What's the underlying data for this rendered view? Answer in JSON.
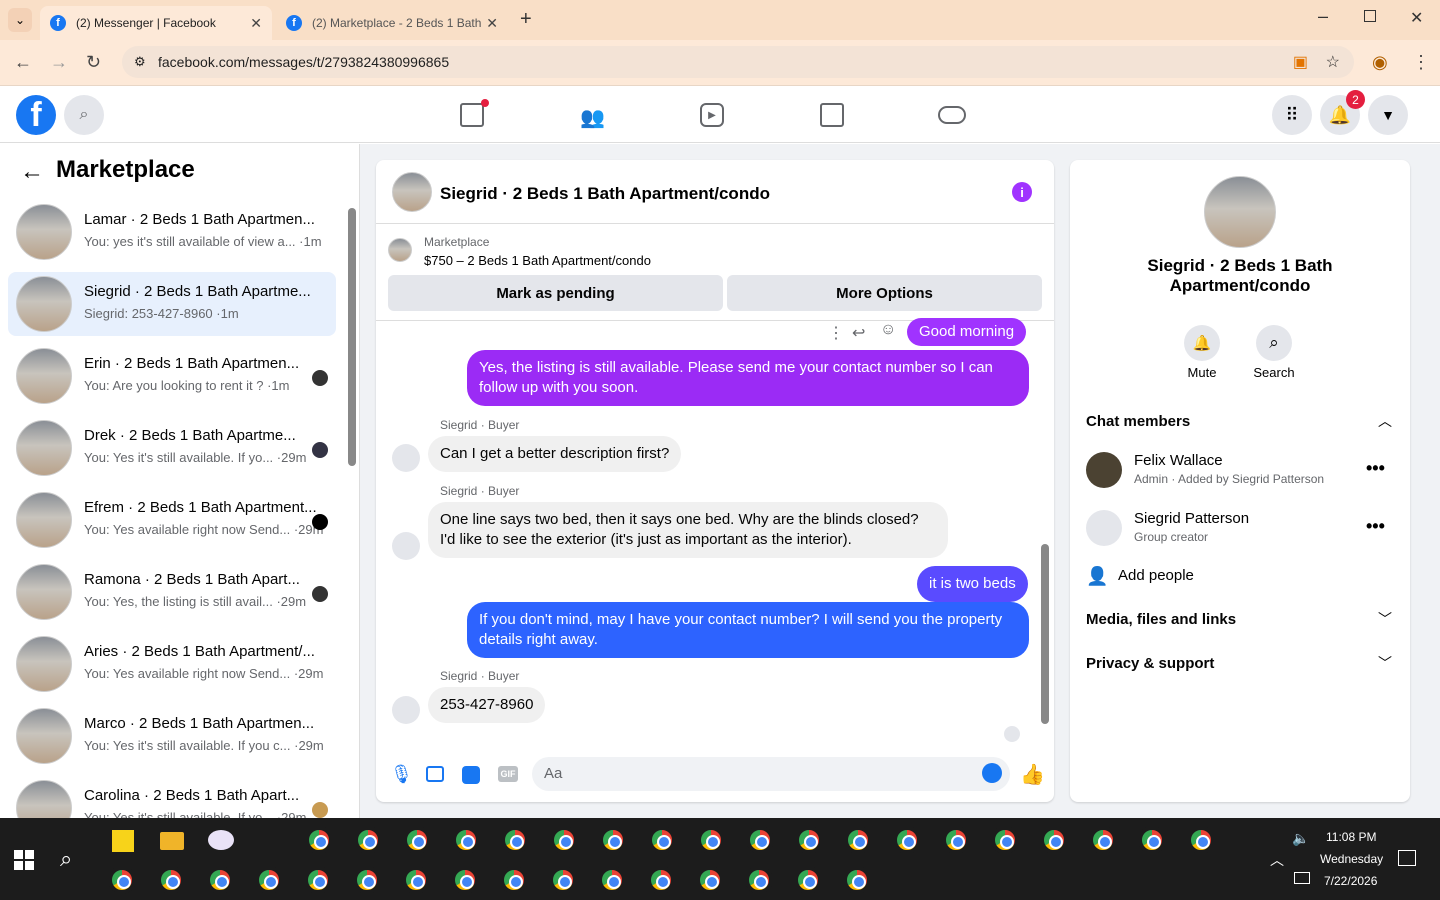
{
  "browser": {
    "tabs": [
      {
        "title": "(2) Messenger | Facebook"
      },
      {
        "title": "(2) Marketplace - 2 Beds 1 Bath"
      }
    ],
    "url": "facebook.com/messages/t/2793824380996865"
  },
  "fb_header": {
    "notifications_count": "2",
    "icons": [
      "facebook-logo",
      "search-icon",
      "home-icon",
      "friends-icon",
      "watch-icon",
      "marketplace-icon",
      "gaming-icon",
      "menu-grid-icon",
      "bell-icon",
      "account-chevron-icon"
    ]
  },
  "sidebar": {
    "title": "Marketplace",
    "conversations": [
      {
        "name": "Lamar · 2 Beds 1 Bath Apartmen...",
        "preview": "You: yes it's still available of view a... ·1m"
      },
      {
        "name": "Siegrid · 2 Beds 1 Bath Apartme...",
        "preview": "Siegrid: 253-427-8960 ·1m"
      },
      {
        "name": "Erin · 2 Beds 1 Bath Apartmen...",
        "preview": "You: Are you looking to rent it ? ·1m"
      },
      {
        "name": "Drek · 2 Beds 1 Bath Apartme...",
        "preview": "You: Yes it's still available. If yo... ·29m"
      },
      {
        "name": "Efrem · 2 Beds 1 Bath Apartment...",
        "preview": "You: Yes available right now Send... ·29m"
      },
      {
        "name": "Ramona · 2 Beds 1 Bath Apart...",
        "preview": "You: Yes, the listing is still avail... ·29m"
      },
      {
        "name": "Aries · 2 Beds 1 Bath Apartment/...",
        "preview": "You: Yes available right now Send... ·29m"
      },
      {
        "name": "Marco · 2 Beds 1 Bath Apartmen...",
        "preview": "You: Yes it's still available. If you c... ·29m"
      },
      {
        "name": "Carolina · 2 Beds 1 Bath Apart...",
        "preview": "You: Yes it's still available. If yo... ·29m"
      }
    ]
  },
  "chat": {
    "title": "Siegrid · 2 Beds 1 Bath Apartment/condo",
    "listing_source": "Marketplace",
    "listing_desc": "$750 – 2 Beds 1 Bath Apartment/condo",
    "mark_pending": "Mark as pending",
    "more_options": "More Options",
    "messages": {
      "m0": "Good morning",
      "m1": "Yes, the listing is still available. Please send me your contact number so I can follow up with you soon.",
      "s1": "Siegrid · Buyer",
      "m2": "Can I get a better description first?",
      "s2": "Siegrid · Buyer",
      "m3": "One line says two bed, then it says one bed. Why are the blinds closed? I'd like to see the exterior (it's just as important as the interior).",
      "m4": "it is two beds",
      "m5": "If you don't mind, may I have your contact number? I will send you the property details right away.",
      "s3": "Siegrid · Buyer",
      "m6": "253-427-8960"
    },
    "composer_placeholder": "Aa"
  },
  "details": {
    "title": "Siegrid · 2 Beds 1 Bath Apartment/condo",
    "mute": "Mute",
    "search": "Search",
    "chat_members": "Chat members",
    "members": [
      {
        "name": "Felix Wallace",
        "role": "Admin · Added by Siegrid Patterson"
      },
      {
        "name": "Siegrid Patterson",
        "role": "Group creator"
      }
    ],
    "add_people": "Add people",
    "media": "Media, files and links",
    "privacy": "Privacy & support"
  },
  "taskbar": {
    "time": "11:08 PM",
    "day": "Wednesday",
    "date": "7/22/2026"
  },
  "colors": {
    "fb_blue": "#1877f2",
    "purple": "#a033ff",
    "bubble_blue": "#2d63ff"
  }
}
